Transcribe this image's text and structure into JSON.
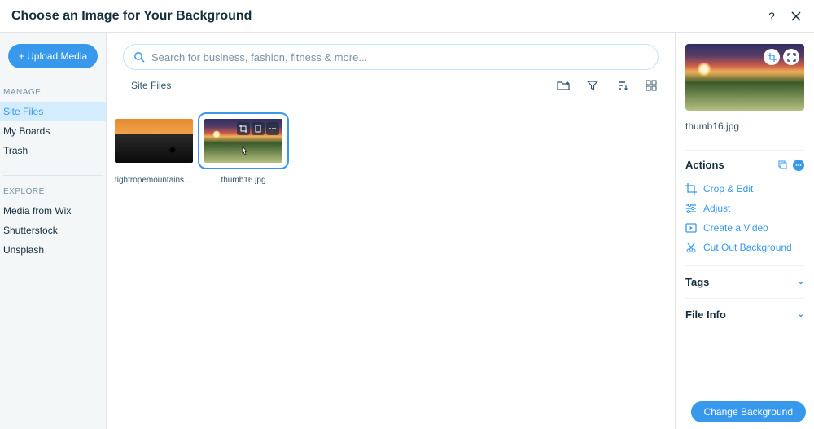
{
  "header": {
    "title": "Choose an Image for Your Background"
  },
  "sidebar": {
    "upload_label": "+ Upload Media",
    "section_manage": "MANAGE",
    "manage_items": [
      "Site Files",
      "My Boards",
      "Trash"
    ],
    "section_explore": "EXPLORE",
    "explore_items": [
      "Media from Wix",
      "Shutterstock",
      "Unsplash"
    ]
  },
  "search": {
    "placeholder": "Search for business, fashion, fitness & more..."
  },
  "toolbar": {
    "breadcrumb": "Site Files"
  },
  "files": [
    {
      "name": "tightropemountains.jpg",
      "selected": false
    },
    {
      "name": "thumb16.jpg",
      "selected": true
    }
  ],
  "panel": {
    "filename": "thumb16.jpg",
    "actions_label": "Actions",
    "actions": [
      "Crop & Edit",
      "Adjust",
      "Create a Video",
      "Cut Out Background"
    ],
    "tags_label": "Tags",
    "fileinfo_label": "File Info"
  },
  "footer": {
    "primary": "Change Background"
  }
}
